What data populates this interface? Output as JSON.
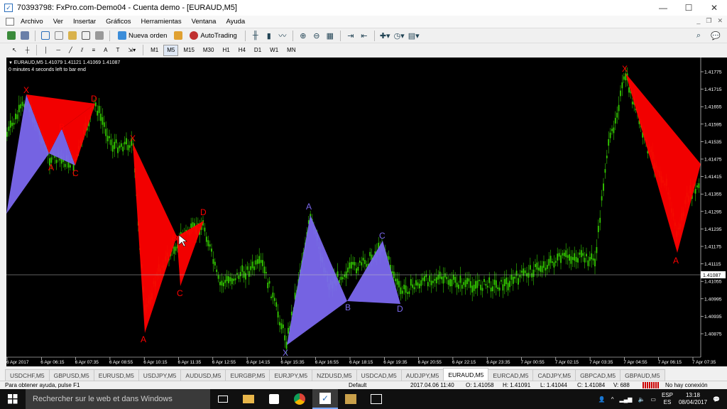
{
  "window": {
    "title": "70393798: FxPro.com-Demo04 - Cuenta demo - [EURAUD,M5]"
  },
  "menu": [
    "Archivo",
    "Ver",
    "Insertar",
    "Gráficos",
    "Herramientas",
    "Ventana",
    "Ayuda"
  ],
  "toolbar": {
    "new_order": "Nueva orden",
    "autotrading": "AutoTrading"
  },
  "timeframes": [
    "M1",
    "M5",
    "M15",
    "M30",
    "H1",
    "H4",
    "D1",
    "W1",
    "MN"
  ],
  "active_timeframe": "M5",
  "chart": {
    "symbol_line": "EURAUD,M5  1.41079 1.41121 1.41069 1.41087",
    "timer_line": "0 minutes 4 seconds left to bar end",
    "current_price_label": "1.41087",
    "price_labels": [
      "1.41775",
      "1.41715",
      "1.41655",
      "1.41595",
      "1.41535",
      "1.41475",
      "1.41415",
      "1.41355",
      "1.41295",
      "1.41235",
      "1.41175",
      "1.41115",
      "1.41055",
      "1.40995",
      "1.40935",
      "1.40875"
    ],
    "time_labels": [
      "6 Apr 2017",
      "6 Apr 06:15",
      "6 Apr 07:35",
      "6 Apr 08:55",
      "6 Apr 10:15",
      "6 Apr 11:35",
      "6 Apr 12:55",
      "6 Apr 14:15",
      "6 Apr 15:35",
      "6 Apr 16:55",
      "6 Apr 18:15",
      "6 Apr 19:35",
      "6 Apr 20:55",
      "6 Apr 22:15",
      "6 Apr 23:35",
      "7 Apr 00:55",
      "7 Apr 02:15",
      "7 Apr 03:35",
      "7 Apr 04:55",
      "7 Apr 06:15",
      "7 Apr 07:35"
    ],
    "pattern_letters": [
      "X",
      "A",
      "B",
      "C",
      "D",
      "X",
      "A",
      "B",
      "C",
      "D",
      "X",
      "A",
      "B",
      "C",
      "D",
      "X",
      "A"
    ],
    "colors": {
      "background": "#000000",
      "candles": "#33cc00",
      "bearish_pattern": "#ff0000",
      "bullish_pattern": "#7b68ee",
      "bid_line": "#c0c0c0"
    }
  },
  "symbol_tabs": [
    "USDCHF,M5",
    "GBPUSD,M5",
    "EURUSD,M5",
    "USDJPY,M5",
    "AUDUSD,M5",
    "EURGBP,M5",
    "EURJPY,M5",
    "NZDUSD,M5",
    "USDCAD,M5",
    "AUDJPY,M5",
    "EURAUD,M5",
    "EURCAD,M5",
    "CADJPY,M5",
    "GBPCAD,M5",
    "GBPAUD,M5"
  ],
  "active_tab": "EURAUD,M5",
  "status": {
    "help": "Para obtener ayuda, pulse F1",
    "profile": "Default",
    "datetime": "2017.04.06 11:40",
    "open": "O: 1.41058",
    "high": "H: 1.41091",
    "low": "L: 1.41044",
    "close": "C: 1.41084",
    "volume": "V: 688",
    "connection": "No hay conexión"
  },
  "taskbar": {
    "search_placeholder": "Rechercher sur le web et dans Windows",
    "language": "ESP",
    "language_sub": "ES",
    "time": "13:18",
    "date": "08/04/2017"
  }
}
